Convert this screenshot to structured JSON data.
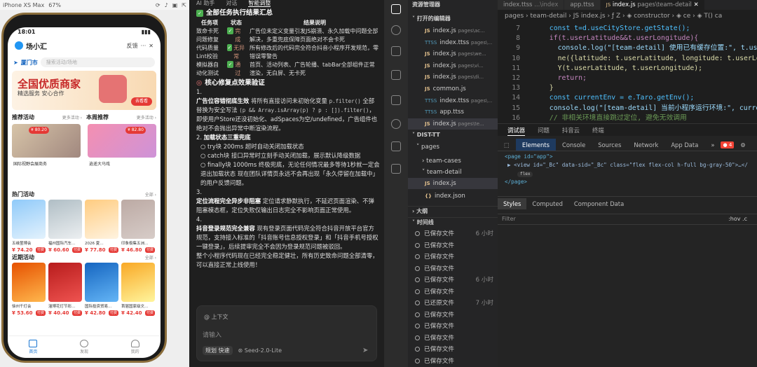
{
  "simulator": {
    "device": "iPhone XS Max",
    "zoom": "67%",
    "status_time": "18:01",
    "app_title": "场小汇",
    "feedback": "反馈",
    "city": "厦门市",
    "search_placeholder": "搜索活动/场地",
    "banner_title": "全国优质商家",
    "banner_sub": "精选服务 安心合作",
    "banner_btn": "去看看",
    "rec_label": "推荐活动",
    "rec_more": "更多活动 ›",
    "local_label": "本周推荐",
    "local_more": "更多活动 ›",
    "rec_items": [
      {
        "price": "¥ 80.20",
        "name": "国际视野会展商务"
      },
      {
        "price": "¥ 82.80",
        "name": "逍遥大马戏"
      }
    ],
    "hot_label": "热门活动",
    "hot_more": "全部 ›",
    "hot_items": [
      {
        "name": "五缘萤博会",
        "price": "¥ 74.20",
        "btn": "付费"
      },
      {
        "name": "福州国际汽车…",
        "price": "¥ 60.60",
        "btn": "付费"
      },
      {
        "name": "2026 夏…",
        "price": "¥ 77.80",
        "btn": "付费"
      },
      {
        "name": "印象极集五洲…",
        "price": "¥ 46.80",
        "btn": "付费"
      }
    ],
    "near_label": "近期活动",
    "near_more": "全部 ›",
    "near_items": [
      {
        "name": "徐州千灯会",
        "price": "¥ 53.60",
        "btn": "付费"
      },
      {
        "name": "淄博花灯节彩…",
        "price": "¥ 40.40",
        "btn": "付费"
      },
      {
        "name": "国际投资贸易…",
        "price": "¥ 42.80",
        "btn": "付费"
      },
      {
        "name": "首届国家级文…",
        "price": "¥ 42.40",
        "btn": "付费"
      }
    ],
    "tabs": [
      "首页",
      "发现",
      "我的"
    ]
  },
  "ai_panel": {
    "tabs": [
      "AI 助手",
      "对话",
      "智能调整"
    ],
    "summary_title": "全部任务执行结果汇总",
    "table_headers": [
      "任务项",
      "状态",
      "结果说明"
    ],
    "rows": [
      {
        "task": "致命卡死问题修复",
        "status": "完成",
        "result": "广告位未定义变量引发JS崩溃、永久加载中问题全部解决，多重兜底保障页面绝对不会卡死"
      },
      {
        "task": "代码质量Lint校验",
        "status": "无异常",
        "result": "所有修改后的代码完全符合抖音小程序开发规范，零错误零警告"
      },
      {
        "task": "模拟器自动化测试",
        "status": "通过",
        "result": "首页、活动列表、广告轮播、tabBar全部组件正常渲染，无白屏、无卡死"
      }
    ],
    "verify_title": "核心修复点效果验证",
    "n1": "1.",
    "p1_bold": "广告位容错彻底生效",
    "p1_text": " 将所有直接访问未初始化变量 ",
    "p1_code": "p.filter()",
    "p1_text2": " 全部替换为安全写法 ",
    "p1_code2": "(p && Array.isArray(p) ? p : []).filter()",
    "p1_text3": "，即使用户Store还没初始化、adSpaces为空/undefined，广告组件也绝对不会抛出异常中断渲染流程。",
    "n2": "2.",
    "p2_title": "加载状态三重兜底",
    "p2_items": [
      "try块 200ms 超时自动关闭加载状态",
      "catch块 接口异常时立刻手动关闭加载，展示默认降级数据",
      "finally块 1000ms 终极兜底，无论任何情况最多等待1秒就一定会退出加载状态 现在团队详情页永远不会再出现「永久停留在加载中」的用户反馈问题。"
    ],
    "n3": "3.",
    "p3_bold": "定位流程完全异步非阻塞",
    "p3_text": " 定位请求静默执行，不延迟页面渲染、不弹阻塞模态框，定位失败仅输出日志完全不影响页面正常使用。",
    "n4": "4.",
    "p4_bold": "抖音登录规范完全兼容",
    "p4_text": " 现有登录页面代码完全符合抖音开放平台官方规范，支持接入标准的「抖音账号信息授权登录」和「抖音手机号授权一键登录」，后续提审完全不会因为登录规范问题被驳回。",
    "p5_text": "整个小程序代码现在已经完全稳定健壮，所有历史致命问题全部清零，可以直接正常上线使用！",
    "input_at": "@ 上下文",
    "input_placeholder": "请输入",
    "mode_label": "规划",
    "mode_fast": "快速",
    "model": "Seed-2.0-Lite"
  },
  "explorer": {
    "title": "资源管理器",
    "open_editors": "打开的编辑器",
    "open_files": [
      {
        "icon": "JS",
        "name": "index.js",
        "path": "pages\\ac...",
        "cls": "js"
      },
      {
        "icon": "TTSS",
        "name": "index.ttss",
        "path": "pages\\...",
        "cls": "ttss"
      },
      {
        "icon": "JS",
        "name": "index.js",
        "path": "pages\\we...",
        "cls": "js"
      },
      {
        "icon": "JS",
        "name": "index.js",
        "path": "pages\\vi...",
        "cls": "js"
      },
      {
        "icon": "JS",
        "name": "index.js",
        "path": "pages\\di...",
        "cls": "js"
      },
      {
        "icon": "JS",
        "name": "common.js",
        "path": "",
        "cls": "js"
      },
      {
        "icon": "TTSS",
        "name": "index.ttss",
        "path": "pages\\...",
        "cls": "ttss"
      },
      {
        "icon": "TTSS",
        "name": "app.ttss",
        "path": "",
        "cls": "ttss"
      },
      {
        "icon": "JS",
        "name": "index.js",
        "path": "pages\\te...",
        "cls": "js"
      }
    ],
    "dist": "DIST-TT",
    "pages": "pages",
    "team_cases": "team-cases",
    "team_detail": "team-detail",
    "index_js": "index.js",
    "index_json": "index.json",
    "outline": "大纲",
    "timeline": "时间线",
    "timeline_items": [
      {
        "label": "已保存文件",
        "time": "6 小时"
      },
      {
        "label": "已保存文件",
        "time": ""
      },
      {
        "label": "已保存文件",
        "time": ""
      },
      {
        "label": "已保存文件",
        "time": ""
      },
      {
        "label": "已保存文件",
        "time": "6 小时"
      },
      {
        "label": "已保存文件",
        "time": ""
      },
      {
        "label": "已还原文件",
        "time": "7 小时"
      },
      {
        "label": "已保存文件",
        "time": ""
      },
      {
        "label": "已保存文件",
        "time": ""
      },
      {
        "label": "已保存文件",
        "time": ""
      },
      {
        "label": "已保存文件",
        "time": ""
      },
      {
        "label": "已保存文件",
        "time": ""
      }
    ]
  },
  "editor": {
    "tabs": [
      {
        "label": "index.ttss",
        "sub": "...\\index"
      },
      {
        "label": "app.ttss",
        "sub": ""
      },
      {
        "label": "index.js",
        "sub": "pages\\team-detail"
      }
    ],
    "breadcrumb": "pages › team-detail › JS index.js › ƒ Z › ◈ constructor › ◈ ce › ◈ T() ca",
    "lines": [
      {
        "n": "7",
        "text": "  const t=d.useCityStore.getState();"
      },
      {
        "n": "8",
        "text": "  if(t.userLatitude&&t.userLongitude){"
      },
      {
        "n": "9",
        "text": "    console.log(\"[team-detail] 使用已有缓存位置:\", t.use"
      },
      {
        "n": "10",
        "text": "    ne({latitude: t.userLatitude, longitude: t.userLong"
      },
      {
        "n": "11",
        "text": "    Y(t.userLatitude, t.userLongitude);"
      },
      {
        "n": "12",
        "text": "    return;"
      },
      {
        "n": "13",
        "text": "  }"
      },
      {
        "n": "14",
        "text": "  const currentEnv = e.Taro.getEnv();"
      },
      {
        "n": "15",
        "text": "  console.log(\"[team-detail] 当前小程序运行环境:\", curre"
      },
      {
        "n": "16",
        "text": "  // 非相关环境直接跳过定位, 避免无效调用"
      }
    ],
    "panel_tabs": [
      "调试器",
      "问题",
      "抖音云",
      "终端"
    ]
  },
  "devtools": {
    "tabs": [
      "Elements",
      "Console",
      "Sources",
      "Network",
      "App Data"
    ],
    "more": "»",
    "errors": "4",
    "dom_line1": "<page id=\"app\">",
    "dom_line2": "▶ <view id=\"_Bc\" data-sid=\"_Bc\" class=\"flex flex-col h-full bg-gray-50\">…</",
    "dom_badge": "flex",
    "dom_line3": "</page>",
    "style_tabs": [
      "Styles",
      "Computed",
      "Component Data"
    ],
    "filter": "Filter",
    "hov": ":hov  .c"
  }
}
